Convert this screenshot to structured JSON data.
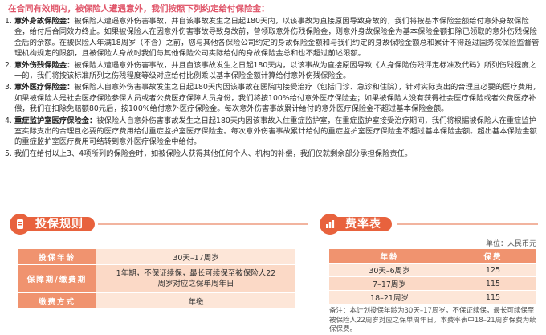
{
  "intro": "在合同有效期内，被保险人遭遇意外，我们按照下列约定给付保险金：",
  "clauses": [
    {
      "num": "1.",
      "title": "意外身故保险金：",
      "text": "被保险人遭遇意外伤害事故，并自该事故发生之日起180天内，以该事故为直接原因导致身故的，我们将按基本保险金额给付意外身故保险金，给付后合同效力终止。如果被保险人在因意外伤害事故导致身故前，曾领取意外伤残保险金，则意外身故保险金为基本保险金额扣除已领取的意外伤残保险金后的余额。在被保险人年满18周岁（不含）之前，您与其他各保险公司约定的身故保险金额和与我们约定的身故保险金额总和累计不得超过国务院保险监督管理机构规定的限额，且被保险人身故时我们与其他保险公司实际给付的身故保险金总和也不超过前述限额。"
    },
    {
      "num": "2.",
      "title": "意外伤残保险金：",
      "text": "被保险人遭遇意外伤害事故，并且自该事故发生之日起180天内，以该事故为直接原因导致《人身保险伤残评定标准及代码》所列伤残程度之一的，我们将按该标准所列之伤残程度等级对应给付比例乘以基本保险金额计算给付意外伤残保险金。"
    },
    {
      "num": "3.",
      "title": "意外医疗保险金：",
      "text": "被保险人自意外伤害事故发生之日起180天内因该事故在医院内接受治疗（包括门诊、急诊和住院），针对实际支出的合理且必要的医疗费用，如果被保险人是社会医疗保险参保人员或者公费医疗保障人员身份，我们将按100%给付意外医疗保险金；如果被保险人没有获得社会医疗保险或者公费医疗补偿，我们在扣除免赔额80元后，按100%给付意外医疗保险金。每次意外伤害事故累计给付的意外医疗保险金不超过基本保险金额。"
    },
    {
      "num": "4.",
      "title": "重症监护室医疗保险金：",
      "text": "被保险人自意外伤害事故发生之日起180天内因该事故入住重症监护室，在重症监护室接受治疗期间，我们将根据被保险人在重症监护室实际支出的合理且必要的医疗费用给付重症监护室医疗保险金。每次意外伤害事故累计给付的重症监护室医疗保险金不超过基本保险金额。超出基本保险金额的重症监护室医疗费用可结转到意外医疗保险金中给付。"
    },
    {
      "num": "5.",
      "title": "",
      "text": "我们在给付以上3、4项所列的保险金时，如被保险人获得其他任何个人、机构的补偿，我们仅就剩余部分承担保险责任。"
    }
  ],
  "rules": {
    "heading": "投保规则",
    "rows": [
      {
        "label": "投保年龄",
        "value": "30天–17周岁"
      },
      {
        "label": "保障期/缴费期",
        "value": "1年期，不保证续保，最长可续保至被保险人22周岁对应之保单周年日"
      },
      {
        "label": "缴费方式",
        "value": "年缴"
      }
    ]
  },
  "rates": {
    "heading": "费率表",
    "unit": "单位：人民币元",
    "col_age": "年龄",
    "col_premium": "保费",
    "rows": [
      {
        "age": "30天–6周岁",
        "premium": "125"
      },
      {
        "age": "7–17周岁",
        "premium": "115"
      },
      {
        "age": "18–21周岁",
        "premium": "115"
      }
    ],
    "note": "备注：本计划投保年龄为30天–17周岁，不保证续保，最长可续保至被保险人22周岁对应之保单周年日。本费率表中18–21周岁保费为续保保费。"
  },
  "colors": {
    "accent": "#e8623d",
    "header_cell": "#f0936f",
    "body_cell": "#fde6d8",
    "intro_text": "#e0566a"
  }
}
